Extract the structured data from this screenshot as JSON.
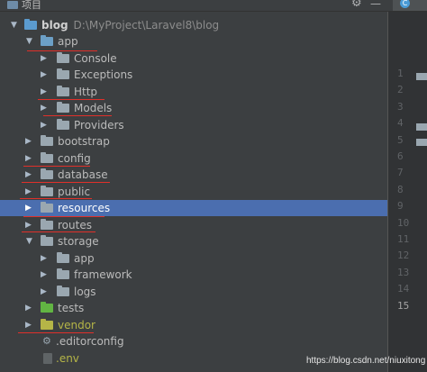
{
  "header": {
    "title": "项目"
  },
  "tree": {
    "root": {
      "name": "blog",
      "path": "D:\\MyProject\\Laravel8\\blog"
    },
    "app": "app",
    "console": "Console",
    "exceptions": "Exceptions",
    "http": "Http",
    "models": "Models",
    "providers": "Providers",
    "bootstrap": "bootstrap",
    "config": "config",
    "database": "database",
    "public": "public",
    "resources": "resources",
    "routes": "routes",
    "storage": "storage",
    "storage_app": "app",
    "framework": "framework",
    "logs": "logs",
    "tests": "tests",
    "vendor": "vendor",
    "editorconfig": ".editorconfig",
    "env": ".env"
  },
  "gutter": {
    "lines": [
      "1",
      "2",
      "3",
      "4",
      "5",
      "6",
      "7",
      "8",
      "9",
      "10",
      "11",
      "12",
      "13",
      "14",
      "15"
    ],
    "active_line": "15"
  },
  "watermark": "https://blog.csdn.net/niuxitong",
  "colors": {
    "selection": "#4b6eaf",
    "underline": "#e0302a",
    "vendor": "#b5b547",
    "tests": "#62b543"
  }
}
